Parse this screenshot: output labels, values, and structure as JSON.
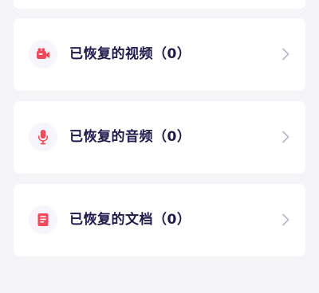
{
  "items": [
    {
      "label": "已恢复的视频（0）",
      "icon": "video-camera-icon"
    },
    {
      "label": "已恢复的音频（0）",
      "icon": "microphone-icon"
    },
    {
      "label": "已恢复的文档（0）",
      "icon": "document-icon"
    }
  ],
  "colors": {
    "background": "#f5f5f8",
    "card": "#ffffff",
    "text": "#1f1a4a",
    "icon_accent": "#ef4a5b",
    "icon_bg": "#f7f4fb",
    "chevron": "#b8b8c4"
  }
}
